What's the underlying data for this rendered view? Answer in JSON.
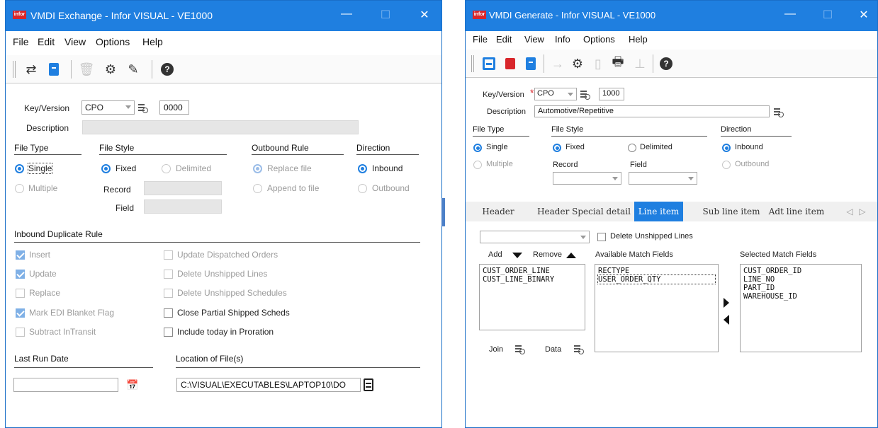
{
  "left_window": {
    "title": "VMDI Exchange - Infor VISUAL - VE1000",
    "logo": "infor",
    "window_buttons": {
      "minimize": "—",
      "maximize": "☐",
      "close": "✕"
    },
    "menu": [
      "File",
      "Edit",
      "View",
      "Options",
      "Help"
    ],
    "toolbar_icons": [
      "transfer-icon",
      "new-document-icon",
      "delete-icon",
      "settings-gear-icon",
      "edit-clear-icon",
      "help-icon"
    ],
    "key_version_label": "Key/Version",
    "key_value": "CPO",
    "version_value": "0000",
    "description_label": "Description",
    "description_value": "",
    "file_type": {
      "label": "File Type",
      "options": [
        "Single",
        "Multiple"
      ],
      "selected": "Single"
    },
    "file_style": {
      "label": "File Style",
      "options": [
        "Fixed",
        "Delimited"
      ],
      "selected": "Fixed",
      "record_label": "Record",
      "field_label": "Field"
    },
    "outbound_rule": {
      "label": "Outbound Rule",
      "options": [
        "Replace file",
        "Append to file"
      ]
    },
    "direction": {
      "label": "Direction",
      "options": [
        "Inbound",
        "Outbound"
      ],
      "selected": "Inbound"
    },
    "inbound_duplicate_rule": {
      "label": "Inbound Duplicate Rule",
      "left": [
        {
          "label": "Insert",
          "checked": true
        },
        {
          "label": "Update",
          "checked": true
        },
        {
          "label": "Replace",
          "checked": false
        },
        {
          "label": "Mark EDI Blanket Flag",
          "checked": true
        },
        {
          "label": "Subtract InTransit",
          "checked": false
        }
      ],
      "right": [
        {
          "label": "Update Dispatched Orders",
          "checked": false
        },
        {
          "label": "Delete Unshipped Lines",
          "checked": false
        },
        {
          "label": "Delete Unshipped Schedules",
          "checked": false
        },
        {
          "label": "Close Partial Shipped Scheds",
          "checked": false
        },
        {
          "label": "Include today in Proration",
          "checked": false
        }
      ]
    },
    "last_run_date_label": "Last Run Date",
    "last_run_date_value": "",
    "location_label": "Location of File(s)",
    "location_value": "C:\\VISUAL\\EXECUTABLES\\LAPTOP10\\DO"
  },
  "right_window": {
    "title": "VMDI Generate - Infor VISUAL - VE1000",
    "logo": "infor",
    "window_buttons": {
      "minimize": "—",
      "maximize": "☐",
      "close": "✕"
    },
    "menu": [
      "File",
      "Edit",
      "View",
      "Info",
      "Options",
      "Help"
    ],
    "toolbar_icons": [
      "save-icon",
      "delete-icon",
      "new-document-icon",
      "arrow-right-icon",
      "settings-gear-icon",
      "copy-icon",
      "print-icon",
      "hierarchy-icon",
      "help-icon"
    ],
    "key_version_label": "Key/Version",
    "required_marker": "*",
    "key_value": "CPO",
    "version_value": "1000",
    "description_label": "Description",
    "description_value": "Automotive/Repetitive",
    "file_type": {
      "label": "File Type",
      "options": [
        "Single",
        "Multiple"
      ],
      "selected": "Single"
    },
    "file_style": {
      "label": "File Style",
      "options": [
        "Fixed",
        "Delimited"
      ],
      "selected": "Fixed",
      "record_label": "Record",
      "field_label": "Field"
    },
    "direction": {
      "label": "Direction",
      "options": [
        "Inbound",
        "Outbound"
      ],
      "selected": "Inbound"
    },
    "tabs": [
      "Header",
      "Header Special detail",
      "Line item",
      "Sub line item",
      "Adt line item"
    ],
    "active_tab": "Line item",
    "delete_unshipped_lines": "Delete Unshipped Lines",
    "add_label": "Add",
    "remove_label": "Remove",
    "available_match_fields_label": "Available Match Fields",
    "selected_match_fields_label": "Selected Match Fields",
    "left_list": [
      "CUST_ORDER_LINE",
      "CUST_LINE_BINARY"
    ],
    "available_list": [
      "RECTYPE",
      "USER_ORDER_QTY"
    ],
    "selected_list": [
      "CUST_ORDER_ID",
      "LINE_NO",
      "PART_ID",
      "WAREHOUSE_ID"
    ],
    "join_label": "Join",
    "data_label": "Data"
  }
}
